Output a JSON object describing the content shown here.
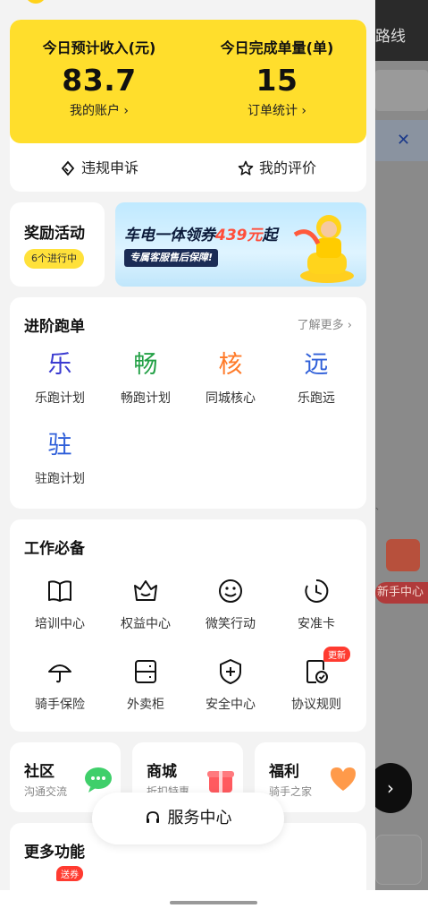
{
  "background": {
    "route_text": "路线",
    "close_text": "✕",
    "newbie_text": "新手中心",
    "fab_text": "›"
  },
  "income": {
    "left": {
      "label": "今日预计收入(元)",
      "value": "83.7",
      "link": "我的账户 ›"
    },
    "right": {
      "label": "今日完成单量(单)",
      "value": "15",
      "link": "订单统计 ›"
    },
    "appeal": "违规申诉",
    "rating": "我的评价"
  },
  "reward": {
    "title": "奖励活动",
    "badge": "6个进行中",
    "banner_prefix": "车电一体领券",
    "banner_amount": "439元",
    "banner_suffix": "起",
    "banner_sub": "专属客服售后保障!"
  },
  "advance": {
    "title": "进阶跑单",
    "more": "了解更多 ›",
    "items": [
      {
        "glyph": "乐",
        "label": "乐跑计划",
        "color": "#3b3bd1"
      },
      {
        "glyph": "畅",
        "label": "畅跑计划",
        "color": "#22a045"
      },
      {
        "glyph": "核",
        "label": "同城核心",
        "color": "#ff7a28"
      },
      {
        "glyph": "远",
        "label": "乐跑远",
        "color": "#2f5fd9"
      },
      {
        "glyph": "驻",
        "label": "驻跑计划",
        "color": "#2f5fd9"
      }
    ]
  },
  "work": {
    "title": "工作必备",
    "items": [
      {
        "icon": "book-icon",
        "label": "培训中心"
      },
      {
        "icon": "crown-icon",
        "label": "权益中心"
      },
      {
        "icon": "smile-icon",
        "label": "微笑行动"
      },
      {
        "icon": "clock-icon",
        "label": "安准卡"
      },
      {
        "icon": "umbrella-icon",
        "label": "骑手保险"
      },
      {
        "icon": "locker-icon",
        "label": "外卖柜"
      },
      {
        "icon": "shield-icon",
        "label": "安全中心"
      },
      {
        "icon": "agreement-icon",
        "label": "协议规则",
        "badge": "更新"
      }
    ]
  },
  "mini": [
    {
      "title": "社区",
      "sub": "沟通交流",
      "icon": "chat-icon"
    },
    {
      "title": "商城",
      "sub": "折扣特惠",
      "icon": "gift-icon"
    },
    {
      "title": "福利",
      "sub": "骑手之家",
      "icon": "heart-icon"
    }
  ],
  "more_func": {
    "title": "更多功能",
    "badge": "送券"
  },
  "service": {
    "label": "服务中心"
  },
  "colors": {
    "accent_yellow": "#ffde2c",
    "badge_red": "#ff3b30"
  }
}
